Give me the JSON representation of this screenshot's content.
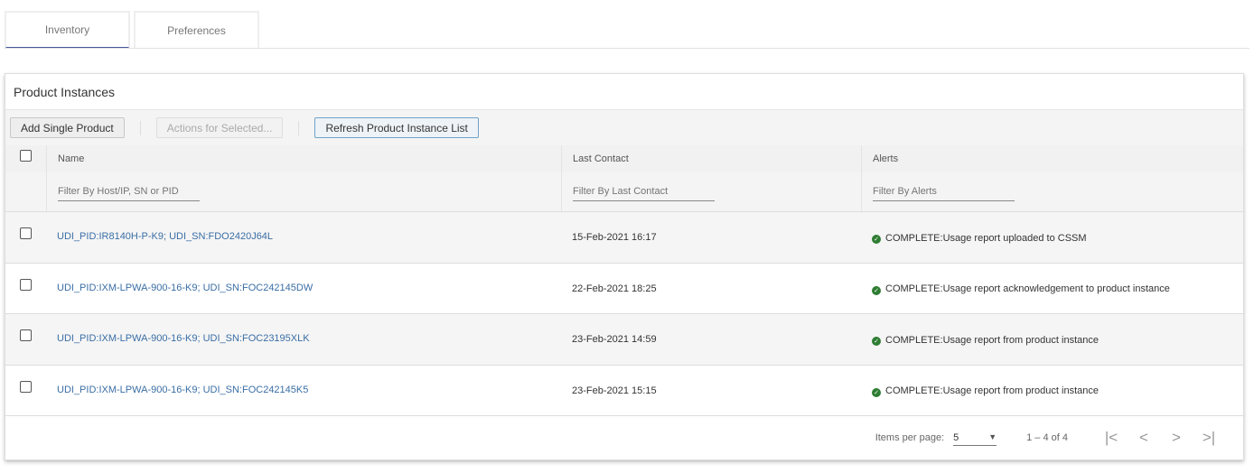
{
  "tabs": [
    {
      "label": "Inventory",
      "active": true
    },
    {
      "label": "Preferences",
      "active": false
    }
  ],
  "card_title": "Product Instances",
  "toolbar": {
    "add": "Add Single Product",
    "actions": "Actions for Selected...",
    "refresh": "Refresh Product Instance List"
  },
  "columns": {
    "name": "Name",
    "last_contact": "Last Contact",
    "alerts": "Alerts"
  },
  "filters": {
    "name": "Filter By Host/IP, SN or PID",
    "last_contact": "Filter By Last Contact",
    "alerts": "Filter By Alerts"
  },
  "rows": [
    {
      "name": "UDI_PID:IR8140H-P-K9; UDI_SN:FDO2420J64L",
      "last_contact": "15-Feb-2021 16:17",
      "alert": "COMPLETE:Usage report uploaded to CSSM"
    },
    {
      "name": "UDI_PID:IXM-LPWA-900-16-K9; UDI_SN:FOC242145DW",
      "last_contact": "22-Feb-2021 18:25",
      "alert": "COMPLETE:Usage report acknowledgement to product instance"
    },
    {
      "name": "UDI_PID:IXM-LPWA-900-16-K9; UDI_SN:FOC23195XLK",
      "last_contact": "23-Feb-2021 14:59",
      "alert": "COMPLETE:Usage report from product instance"
    },
    {
      "name": "UDI_PID:IXM-LPWA-900-16-K9; UDI_SN:FOC242145K5",
      "last_contact": "23-Feb-2021 15:15",
      "alert": "COMPLETE:Usage report from product instance"
    }
  ],
  "pager": {
    "label": "Items per page:",
    "size": "5",
    "range": "1 – 4 of 4",
    "first": "|<",
    "prev": "<",
    "next": ">",
    "last": ">|"
  },
  "colors": {
    "accent": "#4a5a9c",
    "link": "#3a6ea5",
    "success": "#2e7d32"
  }
}
